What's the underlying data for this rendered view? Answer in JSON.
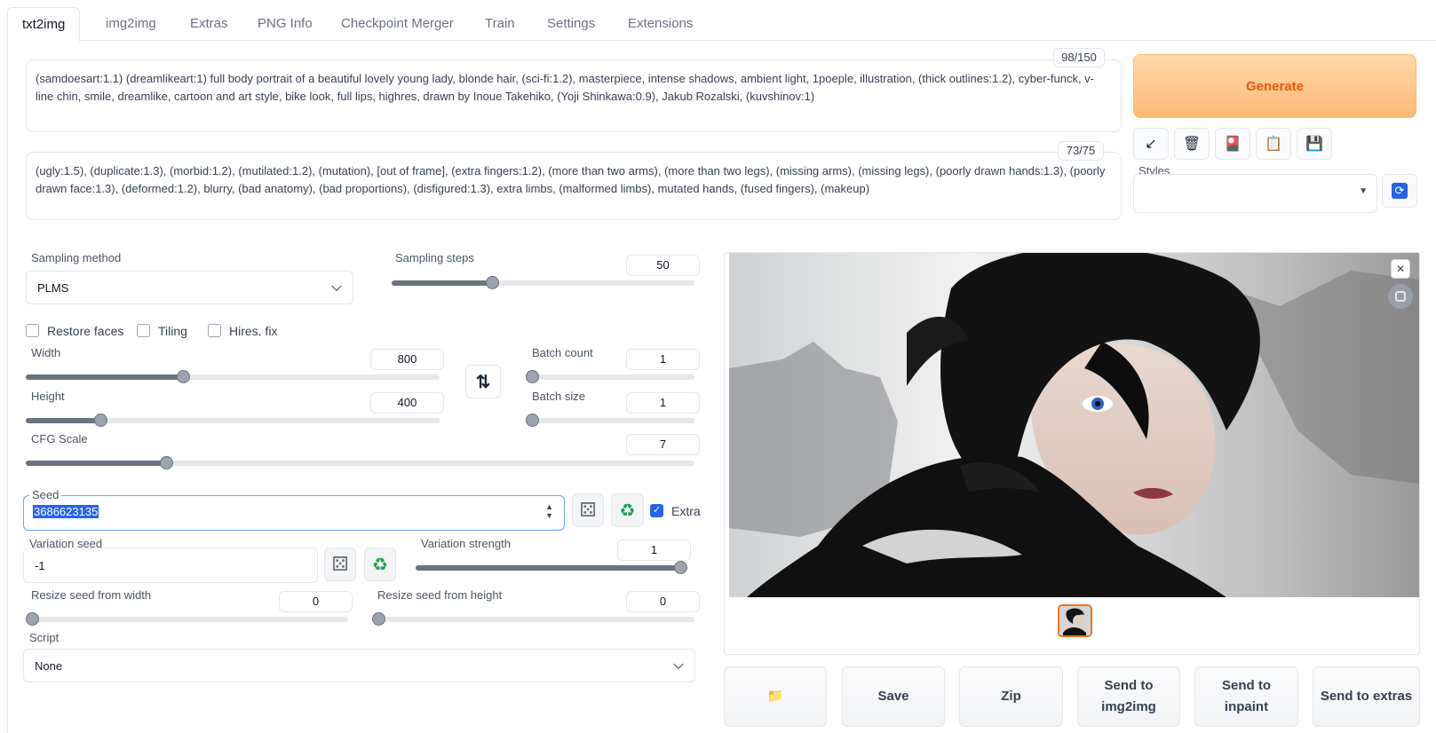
{
  "tabs": [
    "txt2img",
    "img2img",
    "Extras",
    "PNG Info",
    "Checkpoint Merger",
    "Train",
    "Settings",
    "Extensions"
  ],
  "prompt": {
    "text": "(samdoesart:1.1) (dreamlikeart:1) full body portrait of a beautiful lovely young lady, blonde hair, (sci-fi:1.2), masterpiece, intense shadows, ambient light, 1poeple, illustration, (thick outlines:1.2),  cyber-funck, v-line chin, smile, dreamlike, cartoon and art style, bike look, full lips, highres, drawn by Inoue Takehiko, (Yoji Shinkawa:0.9), Jakub Rozalski, (kuvshinov:1)",
    "token_count": "98/150"
  },
  "negative_prompt": {
    "text": "(ugly:1.5), (duplicate:1.3), (morbid:1.2), (mutilated:1.2), (mutation), [out of frame], (extra fingers:1.2), (more than two arms), (more than two legs), (missing arms), (missing legs), (poorly drawn hands:1.3), (poorly drawn face:1.3), (deformed:1.2), blurry, (bad anatomy), (bad proportions), (disfigured:1.3), extra limbs, (malformed limbs), mutated hands, (fused fingers), (makeup)",
    "token_count": "73/75"
  },
  "generate_label": "Generate",
  "tool_icons": [
    "arrow-icon",
    "trash-icon",
    "card-icon",
    "clipboard-icon",
    "save-icon"
  ],
  "styles": {
    "label": "Styles",
    "value": ""
  },
  "sampling": {
    "method_label": "Sampling method",
    "method": "PLMS",
    "steps_label": "Sampling steps",
    "steps": "50",
    "steps_fraction": 0.33
  },
  "options": {
    "restore_faces": "Restore faces",
    "tiling": "Tiling",
    "hires_fix": "Hires. fix"
  },
  "width": {
    "label": "Width",
    "value": "800",
    "fraction": 0.38
  },
  "height": {
    "label": "Height",
    "value": "400",
    "fraction": 0.18
  },
  "batch_count": {
    "label": "Batch count",
    "value": "1",
    "fraction": 0
  },
  "batch_size": {
    "label": "Batch size",
    "value": "1",
    "fraction": 0
  },
  "cfg": {
    "label": "CFG Scale",
    "value": "7",
    "fraction": 0.21
  },
  "seed": {
    "label": "Seed",
    "value": "3686623135",
    "extra_label": "Extra"
  },
  "variation_seed": {
    "label": "Variation seed",
    "value": "-1"
  },
  "variation_strength": {
    "label": "Variation strength",
    "value": "1",
    "fraction": 1
  },
  "resize_w": {
    "label": "Resize seed from width",
    "value": "0",
    "fraction": 0
  },
  "resize_h": {
    "label": "Resize seed from height",
    "value": "0",
    "fraction": 0
  },
  "script": {
    "label": "Script",
    "value": "None"
  },
  "actions": {
    "folder": "📁",
    "save": "Save",
    "zip": "Zip",
    "img2img_1": "Send to",
    "img2img_2": "img2img",
    "inpaint_1": "Send to",
    "inpaint_2": "inpaint",
    "extras": "Send to extras"
  },
  "glyphs": {
    "swap": "⇅",
    "dice": "⚄",
    "recycle": "♻",
    "close": "✕",
    "refresh": "⟳",
    "arrow": "↙",
    "trash": "🗑",
    "card": "🎴",
    "clipboard": "📋",
    "floppy": "💾",
    "check": "✓"
  }
}
